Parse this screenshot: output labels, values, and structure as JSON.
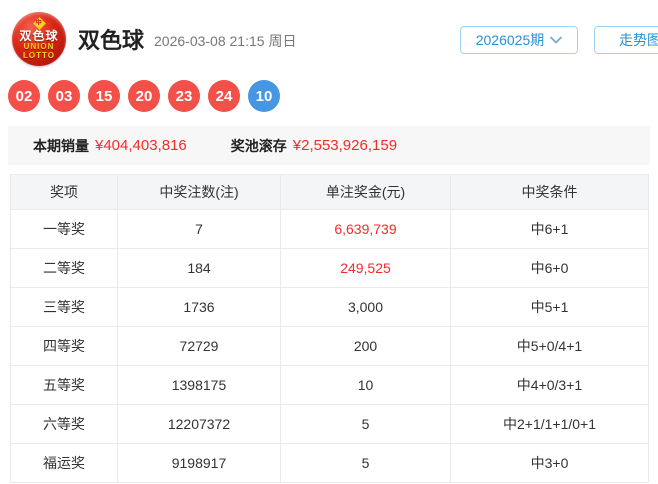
{
  "header": {
    "logo": {
      "mark": "中",
      "cn": "双色球",
      "en1": "UNION",
      "en2": "LOTTO"
    },
    "title": "双色球",
    "datetime": "2026-03-08 21:15 周日",
    "period_selector": "2026025期",
    "trend_button": "走势图"
  },
  "draw": {
    "red_balls": [
      "02",
      "03",
      "15",
      "20",
      "23",
      "24"
    ],
    "blue_ball": "10"
  },
  "sales": {
    "sales_label": "本期销量",
    "sales_value": "¥404,403,816",
    "pool_label": "奖池滚存",
    "pool_value": "¥2,553,926,159"
  },
  "table": {
    "headers": [
      "奖项",
      "中奖注数(注)",
      "单注奖金(元)",
      "中奖条件"
    ],
    "rows": [
      {
        "prize": "一等奖",
        "count": "7",
        "amount": "6,639,739",
        "condition": "中6+1"
      },
      {
        "prize": "二等奖",
        "count": "184",
        "amount": "249,525",
        "condition": "中6+0"
      },
      {
        "prize": "三等奖",
        "count": "1736",
        "amount": "3,000",
        "condition": "中5+1"
      },
      {
        "prize": "四等奖",
        "count": "72729",
        "amount": "200",
        "condition": "中5+0/4+1"
      },
      {
        "prize": "五等奖",
        "count": "1398175",
        "amount": "10",
        "condition": "中4+0/3+1"
      },
      {
        "prize": "六等奖",
        "count": "12207372",
        "amount": "5",
        "condition": "中2+1/1+1/0+1"
      },
      {
        "prize": "福运奖",
        "count": "9198917",
        "amount": "5",
        "condition": "中3+0"
      }
    ]
  },
  "colors": {
    "red_ball": "#f25048",
    "blue_ball": "#4796e3",
    "highlight_red": "#f42a2a",
    "accent_blue": "#2593d2",
    "accent_border": "#9fd2f1"
  }
}
